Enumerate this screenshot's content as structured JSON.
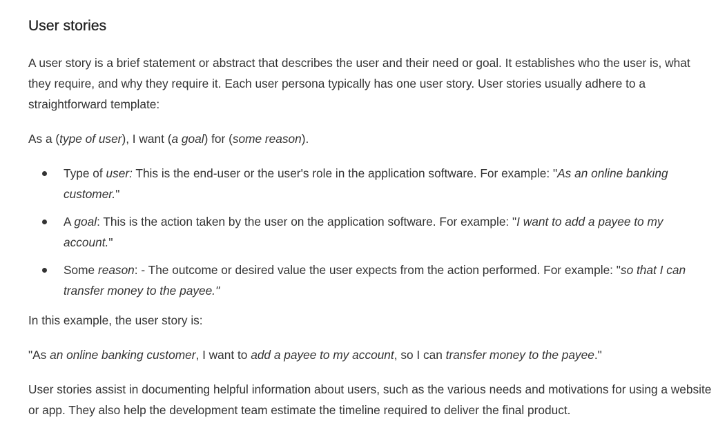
{
  "heading": "User stories",
  "intro": "A user story is a brief statement or abstract that describes the user and their need or goal. It establishes who the user is, what they require, and why they require it. Each user persona typically has one user story. User stories usually adhere to a straightforward template:",
  "template": {
    "t1": "As a (",
    "em1": "type of user",
    "t2": "), I want (",
    "em2": "a goal",
    "t3": ") for (",
    "em3": "some reason",
    "t4": ")."
  },
  "bullets": [
    {
      "pre": "Type of ",
      "em_label": "user:",
      "text": " This is the end-user or the user's role in the application software. For example: \"",
      "em_example": "As an online banking customer.",
      "post": "\""
    },
    {
      "pre": " A ",
      "em_label": "goal",
      "text": ": This is the action taken by the user on the application software. For example: \"",
      "em_example": "I want to add a payee to my account.",
      "post": "\""
    },
    {
      "pre": " Some ",
      "em_label": "reason",
      "text": ": - The outcome or desired value the user expects from the action performed. For example: \"",
      "em_example": "so that I can transfer money to the payee.\"",
      "post": ""
    }
  ],
  "example_intro": " In this example, the user story is:",
  "example": {
    "t1": " \"As ",
    "em1": "an online banking customer",
    "t2": ", I want to ",
    "em2": "add a payee to my account",
    "t3": ", so I can ",
    "em3": "transfer money to the payee",
    "t4": ".\""
  },
  "closing": "User stories assist in documenting helpful information about users, such as the various needs and motivations for using a website or app. They also help the development team estimate the timeline required to deliver the final product."
}
